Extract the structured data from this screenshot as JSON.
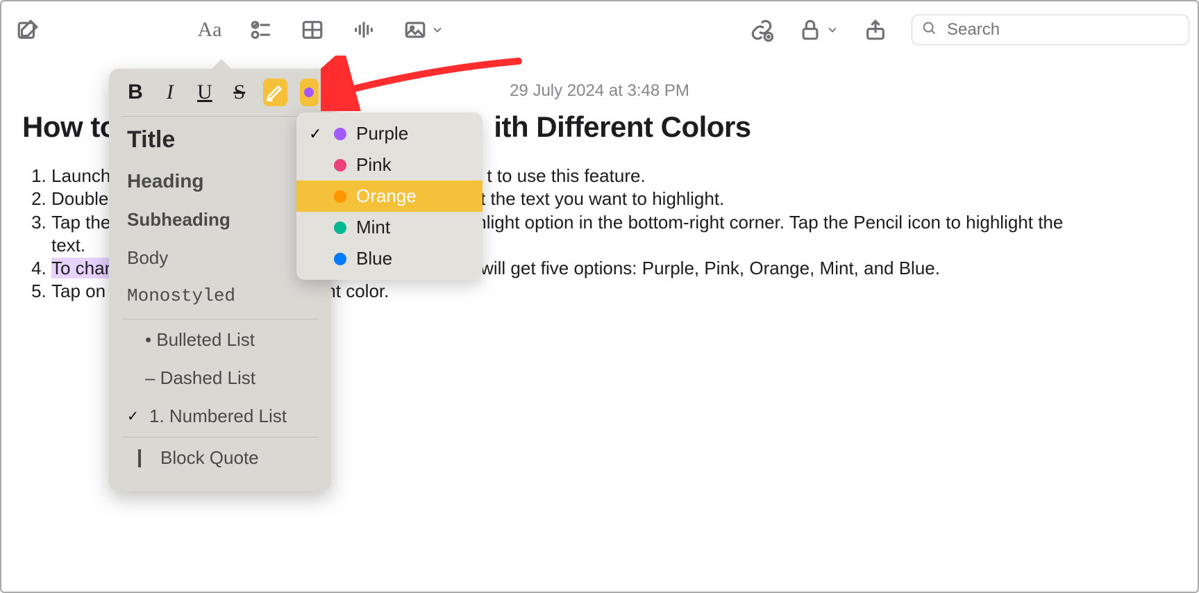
{
  "toolbar": {
    "compose_icon": "compose",
    "format_icon": "Aa",
    "checklist_icon": "checklist",
    "table_icon": "table",
    "audio_icon": "audio-wave",
    "media_icon": "photo",
    "link_icon": "link-plus",
    "lock_icon": "lock",
    "share_icon": "share",
    "search_placeholder": "Search"
  },
  "note": {
    "timestamp": "29 July 2024 at 3:48 PM",
    "title_left": "How to",
    "title_right": "ith Different Colors",
    "list": {
      "i1": "Launch",
      "i2": "Double-",
      "i3a": "Tap the",
      "i3b": "text.",
      "i4": "To chan",
      "i5": "Tap on ",
      "frag1": "t to use this feature.",
      "frag2": "t the text you want to highlight.",
      "frag3": "hlight option in the bottom-right corner. Tap the Pencil icon to highlight the",
      "frag4": "will get five options: Purple, Pink, Orange, Mint, and Blue.",
      "frag5": "nt color."
    }
  },
  "aa_popover": {
    "bold": "B",
    "italic": "I",
    "underline": "U",
    "strike": "S",
    "styles": {
      "title": "Title",
      "heading": "Heading",
      "subheading": "Subheading",
      "body": "Body",
      "mono": "Monostyled",
      "bulleted": "•  Bulleted List",
      "dashed": "–  Dashed List",
      "numbered": "1.  Numbered List",
      "blockquote": "Block Quote"
    },
    "check": "✓"
  },
  "color_menu": {
    "purple": "Purple",
    "pink": "Pink",
    "orange": "Orange",
    "mint": "Mint",
    "blue": "Blue",
    "check": "✓",
    "selected": "orange",
    "checked": "purple"
  }
}
